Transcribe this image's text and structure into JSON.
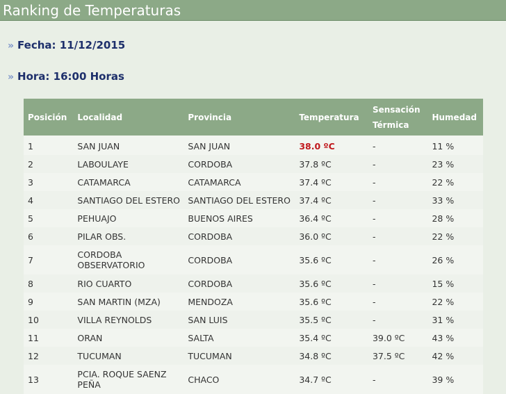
{
  "header": {
    "title": "Ranking de Temperaturas"
  },
  "info": {
    "fecha_label": "Fecha: 11/12/2015",
    "hora_label": "Hora: 16:00 Horas",
    "arrow_glyph": "»"
  },
  "table": {
    "columns": [
      "Posición",
      "Localidad",
      "Provincia",
      "Temperatura",
      "Sensación Térmica",
      "Humedad"
    ],
    "rows": [
      {
        "pos": "1",
        "localidad": "SAN JUAN",
        "provincia": "SAN JUAN",
        "temperatura": "38.0 ºC",
        "sensacion": "-",
        "humedad": "11 %"
      },
      {
        "pos": "2",
        "localidad": "LABOULAYE",
        "provincia": "CORDOBA",
        "temperatura": "37.8 ºC",
        "sensacion": "-",
        "humedad": "23 %"
      },
      {
        "pos": "3",
        "localidad": "CATAMARCA",
        "provincia": "CATAMARCA",
        "temperatura": "37.4 ºC",
        "sensacion": "-",
        "humedad": "22 %"
      },
      {
        "pos": "4",
        "localidad": "SANTIAGO DEL ESTERO",
        "provincia": "SANTIAGO DEL ESTERO",
        "temperatura": "37.4 ºC",
        "sensacion": "-",
        "humedad": "33 %"
      },
      {
        "pos": "5",
        "localidad": "PEHUAJO",
        "provincia": "BUENOS AIRES",
        "temperatura": "36.4 ºC",
        "sensacion": "-",
        "humedad": "28 %"
      },
      {
        "pos": "6",
        "localidad": "PILAR OBS.",
        "provincia": "CORDOBA",
        "temperatura": "36.0 ºC",
        "sensacion": "-",
        "humedad": "22 %"
      },
      {
        "pos": "7",
        "localidad": "CORDOBA OBSERVATORIO",
        "provincia": "CORDOBA",
        "temperatura": "35.6 ºC",
        "sensacion": "-",
        "humedad": "26 %"
      },
      {
        "pos": "8",
        "localidad": "RIO CUARTO",
        "provincia": "CORDOBA",
        "temperatura": "35.6 ºC",
        "sensacion": "-",
        "humedad": "15 %"
      },
      {
        "pos": "9",
        "localidad": "SAN MARTIN (MZA)",
        "provincia": "MENDOZA",
        "temperatura": "35.6 ºC",
        "sensacion": "-",
        "humedad": "22 %"
      },
      {
        "pos": "10",
        "localidad": "VILLA REYNOLDS",
        "provincia": "SAN LUIS",
        "temperatura": "35.5 ºC",
        "sensacion": "-",
        "humedad": "31 %"
      },
      {
        "pos": "11",
        "localidad": "ORAN",
        "provincia": "SALTA",
        "temperatura": "35.4 ºC",
        "sensacion": "39.0 ºC",
        "humedad": "43 %"
      },
      {
        "pos": "12",
        "localidad": "TUCUMAN",
        "provincia": "TUCUMAN",
        "temperatura": "34.8 ºC",
        "sensacion": "37.5 ºC",
        "humedad": "42 %"
      },
      {
        "pos": "13",
        "localidad": "PCIA. ROQUE SAENZ PEÑA",
        "provincia": "CHACO",
        "temperatura": "34.7 ºC",
        "sensacion": "-",
        "humedad": "39 %"
      }
    ]
  },
  "colors": {
    "header_bg": "#8ca987",
    "page_bg": "#e9efe6",
    "info_text": "#1d2f6b",
    "max_temp": "#c0181c"
  }
}
